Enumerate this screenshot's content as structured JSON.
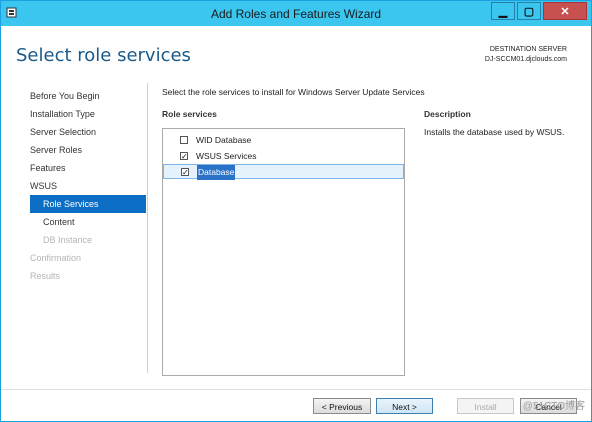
{
  "window": {
    "title": "Add Roles and Features Wizard"
  },
  "header": {
    "page_title": "Select role services",
    "destination_label": "DESTINATION SERVER",
    "destination_server": "DJ-SCCM01.djclouds.com"
  },
  "nav": {
    "items": [
      {
        "label": "Before You Begin",
        "state": "normal"
      },
      {
        "label": "Installation Type",
        "state": "normal"
      },
      {
        "label": "Server Selection",
        "state": "normal"
      },
      {
        "label": "Server Roles",
        "state": "normal"
      },
      {
        "label": "Features",
        "state": "normal"
      },
      {
        "label": "WSUS",
        "state": "normal"
      },
      {
        "label": "Role Services",
        "state": "active"
      },
      {
        "label": "Content",
        "state": "normal"
      },
      {
        "label": "DB Instance",
        "state": "disabled"
      },
      {
        "label": "Confirmation",
        "state": "disabled"
      },
      {
        "label": "Results",
        "state": "disabled"
      }
    ]
  },
  "main": {
    "instruction": "Select the role services to install for Windows Server Update Services",
    "role_services_header": "Role services",
    "role_services": [
      {
        "label": "WID Database",
        "checked": false
      },
      {
        "label": "WSUS Services",
        "checked": true
      },
      {
        "label": "Database",
        "checked": true,
        "selected": true
      }
    ],
    "description_header": "Description",
    "description": "Installs the database used by WSUS."
  },
  "buttons": {
    "previous": "< Previous",
    "next": "Next >",
    "install": "Install",
    "cancel": "Cancel"
  },
  "watermark": "@51CTO博客",
  "colors": {
    "titlebar": "#3bc6f0",
    "nav_active": "#0d6ec6",
    "title_text": "#1a5a8a"
  }
}
